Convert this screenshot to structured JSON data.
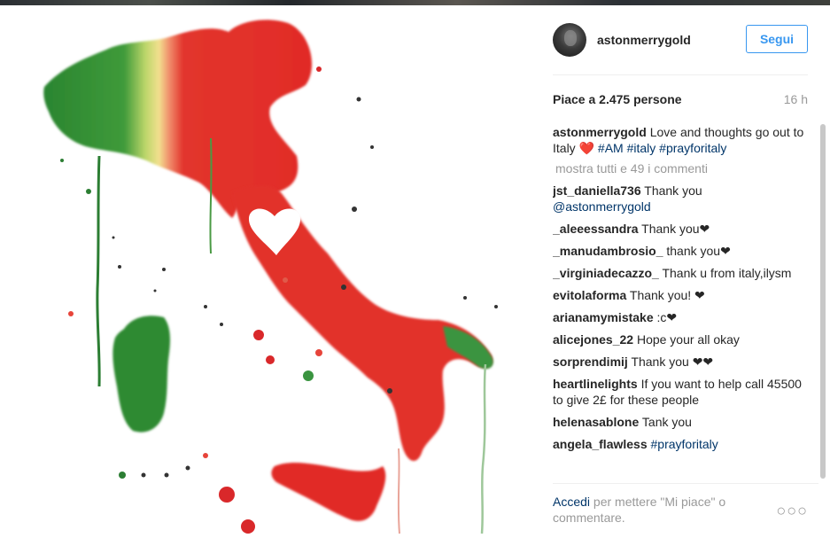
{
  "post": {
    "username": "astonmerrygold",
    "follow_label": "Segui",
    "likes_text": "Piace a 2.475 persone",
    "time_ago": "16 h",
    "caption": {
      "user": "astonmerrygold",
      "text": "Love and thoughts go out to Italy",
      "emoji": "❤️",
      "hashtags": "#AM #italy #prayforitaly"
    },
    "show_more_label": "mostra tutti e 49 i commenti",
    "comments": [
      {
        "user": "jst_daniella736",
        "text": "Thank you",
        "mention": "@astonmerrygold"
      },
      {
        "user": "_aleeessandra",
        "text": "Thank you❤"
      },
      {
        "user": "_manudambrosio_",
        "text": "thank you❤"
      },
      {
        "user": "_virginiadecazzo_",
        "text": "Thank u from italy,ilysm"
      },
      {
        "user": "evitolaforma",
        "text": "Thank you! ❤"
      },
      {
        "user": "arianamymistake",
        "text": ":c❤"
      },
      {
        "user": "alicejones_22",
        "text": "Hope your all okay"
      },
      {
        "user": "sorprendimij",
        "text": "Thank you ❤❤"
      },
      {
        "user": "heartlinelights",
        "text": "If you want to help call 45500 to give 2£ for these people"
      },
      {
        "user": "helenasablone",
        "text": "Tank you"
      },
      {
        "user": "angela_flawless",
        "hashtag": "#prayforitaly"
      }
    ],
    "footer": {
      "login_link": "Accedi",
      "login_text": "per mettere \"Mi piace\" o commentare.",
      "options_icon": "more-options-icon",
      "options_glyph": "○○○"
    }
  },
  "colors": {
    "link_blue": "#3897f0",
    "hashtag_blue": "#003569",
    "green": "#2f8a33",
    "red": "#e0302c"
  }
}
